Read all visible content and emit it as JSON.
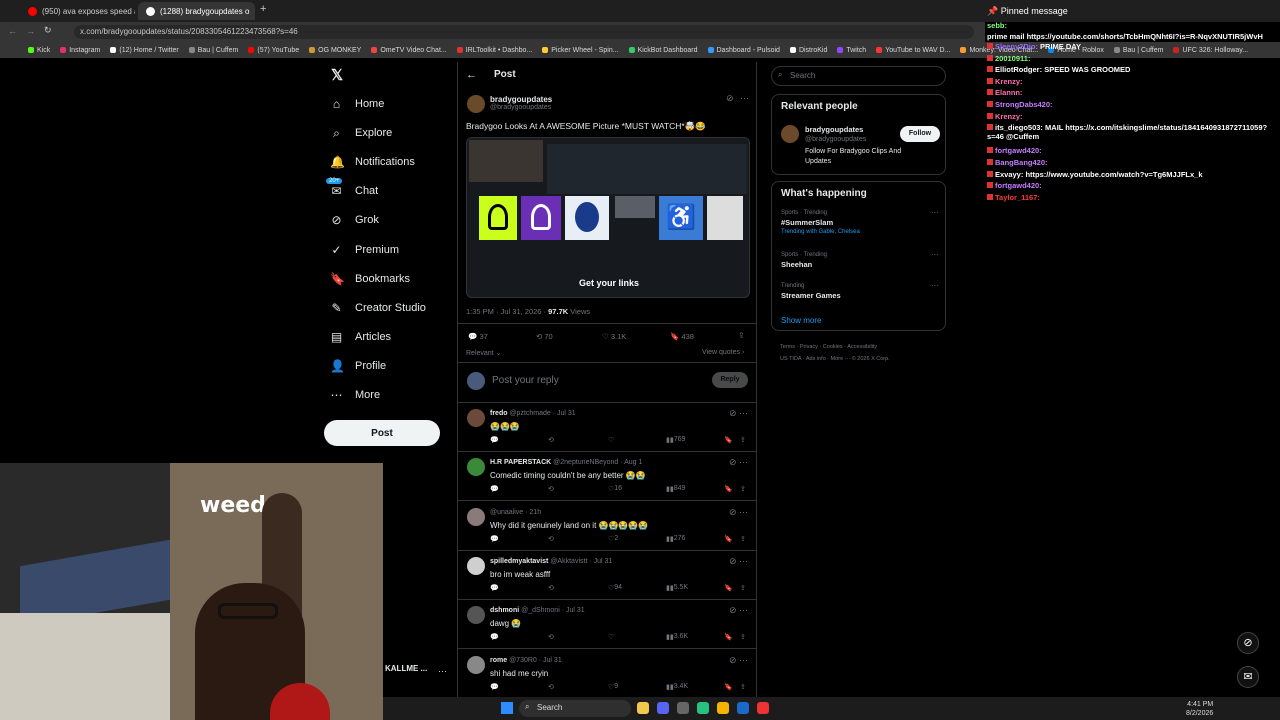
{
  "browser": {
    "tabs": [
      {
        "title": "(950) ava exposes speed and p"
      },
      {
        "title": "(1288) bradygoupdates o"
      }
    ],
    "url": "x.com/bradygooupdates/status/2083305461223473568?s=46",
    "bookmarks": [
      "Kick",
      "Instagram",
      "(12) Home / Twitter",
      "Bau | Cuffem",
      "(57) YouTube",
      "OG MONKEY",
      "OmeTV Video Chat...",
      "IRLToolkit • Dashbo...",
      "Picker Wheel - Spin...",
      "KickBot Dashboard",
      "Dashboard - Pulsoid",
      "DistroKid",
      "Twitch",
      "YouTube to WAV D...",
      "Monkey: Video Chat...",
      "Home - Roblox",
      "Bau | Cuffem",
      "UFC 326: Holloway..."
    ],
    "all_bookmarks": "All Bookmarks"
  },
  "nav": {
    "items": [
      {
        "label": "Home"
      },
      {
        "label": "Explore"
      },
      {
        "label": "Notifications"
      },
      {
        "label": "Chat"
      },
      {
        "label": "Grok"
      },
      {
        "label": "Premium"
      },
      {
        "label": "Bookmarks"
      },
      {
        "label": "Creator Studio"
      },
      {
        "label": "Articles"
      },
      {
        "label": "Profile"
      },
      {
        "label": "More"
      }
    ],
    "chat_badge": "20+",
    "post_button": "Post",
    "account_name": "KALLME ..."
  },
  "post": {
    "header": "Post",
    "author": "bradygoupdates",
    "handle": "@bradygooupdates",
    "text": "Bradygoo Looks At A AWESOME Picture *MUST WATCH*🤯😂",
    "image_caption": "Get your links",
    "timestamp": "1:35 PM · Jul 31, 2026 ·",
    "views_count": "97.7K",
    "views_label": "Views",
    "stats": {
      "replies": "37",
      "reposts": "70",
      "likes": "3.1K",
      "bookmarks": "438"
    },
    "relevant": "Relevant",
    "view_quotes": "View quotes",
    "reply_placeholder": "Post your reply",
    "reply_button": "Reply"
  },
  "replies": [
    {
      "name": "fredo",
      "handle": "@pztchmade · Jul 31",
      "text": "😭😭😭",
      "likes": "",
      "views": "769",
      "color": "#6b4a3a"
    },
    {
      "name": "H.R PAPERSTACK",
      "handle": "@2neptuneNBeyond · Aug 1",
      "text": "Comedic timing couldn't be any better 😭😭",
      "likes": "16",
      "views": "849",
      "color": "#3a8a3a"
    },
    {
      "name": "",
      "handle": "@unaalive · 21h",
      "text": "Why did it genuinely land on it 😭😭😭😭😭",
      "likes": "2",
      "views": "276",
      "color": "#8a7a7a"
    },
    {
      "name": "spilledmyaktavist",
      "handle": "@Akktavistt · Jul 31",
      "text": "bro im weak asfff",
      "likes": "94",
      "views": "5.5K",
      "color": "#cfcfcf"
    },
    {
      "name": "dshmoni",
      "handle": "@_dShmoni · Jul 31",
      "text": "dawg 😭",
      "likes": "",
      "views": "3.6K",
      "color": "#555"
    },
    {
      "name": "rome",
      "handle": "@730R0 · Jul 31",
      "text": "shi had me cryin",
      "likes": "9",
      "views": "3.4K",
      "color": "#888"
    }
  ],
  "sidebar": {
    "search_placeholder": "Search",
    "relevant_title": "Relevant people",
    "person_name": "bradygoupdates",
    "person_handle": "@bradygooupdates",
    "person_bio": "Follow For Bradygoo Clips And Updates",
    "follow": "Follow",
    "happening_title": "What's happening",
    "trends": [
      {
        "meta": "Sports · Trending",
        "title": "#SummerSlam",
        "sub": "Trending with Gable, Chelsea"
      },
      {
        "meta": "Sports · Trending",
        "title": "Sheehan",
        "sub": ""
      },
      {
        "meta": "Trending",
        "title": "Streamer Games",
        "sub": ""
      }
    ],
    "show_more": "Show more",
    "footer1": "Terms · Privacy · Cookies · Accessibility",
    "footer2": "US TIDA · Ads info · More ··· © 2026 X Corp."
  },
  "chat": {
    "pinned_label": "Pinned message",
    "pinned_user": "sebb:",
    "pinned_text": "prime mail https://youtube.com/shorts/TcbHmQNht6I?is=R-NqvXNUTIR5jWvH",
    "lines": [
      {
        "user": "Sleepy2Dio:",
        "text": "PRIME DAY",
        "color": "#9b6bff"
      },
      {
        "user": "20010911:",
        "text": "",
        "color": "#7fff7f"
      },
      {
        "user": "ElliotRodger:",
        "text": "SPEED WAS GROOMED",
        "color": "#ffffff"
      },
      {
        "user": "Krenzy:",
        "text": "",
        "color": "#ff6fb0"
      },
      {
        "user": "Elannn:",
        "text": "",
        "color": "#ff6fb0"
      },
      {
        "user": "StrongDabs420:",
        "text": "",
        "color": "#c77dff"
      },
      {
        "user": "Krenzy:",
        "text": "",
        "color": "#ff6fb0"
      },
      {
        "user": "its_diego503:",
        "text": "MAIL https://x.com/itskingslime/status/1841640931872711059?s=46 @Cuffem",
        "color": "#ffffff"
      },
      {
        "user": "fortgawd420:",
        "text": "",
        "color": "#c77dff"
      },
      {
        "user": "BangBang420:",
        "text": "",
        "color": "#c77dff"
      },
      {
        "user": "Exvayy:",
        "text": "https://www.youtube.com/watch?v=Tg6MJJFLx_k",
        "color": "#ffffff"
      },
      {
        "user": "fortgawd420:",
        "text": "",
        "color": "#c77dff"
      },
      {
        "user": "Taylor_1167:",
        "text": "",
        "color": "#ff3b3b"
      }
    ]
  },
  "webcam": {
    "sign_text": "weedm"
  },
  "taskbar": {
    "search": "Search",
    "time": "4:41 PM",
    "date": "8/2/2026"
  }
}
